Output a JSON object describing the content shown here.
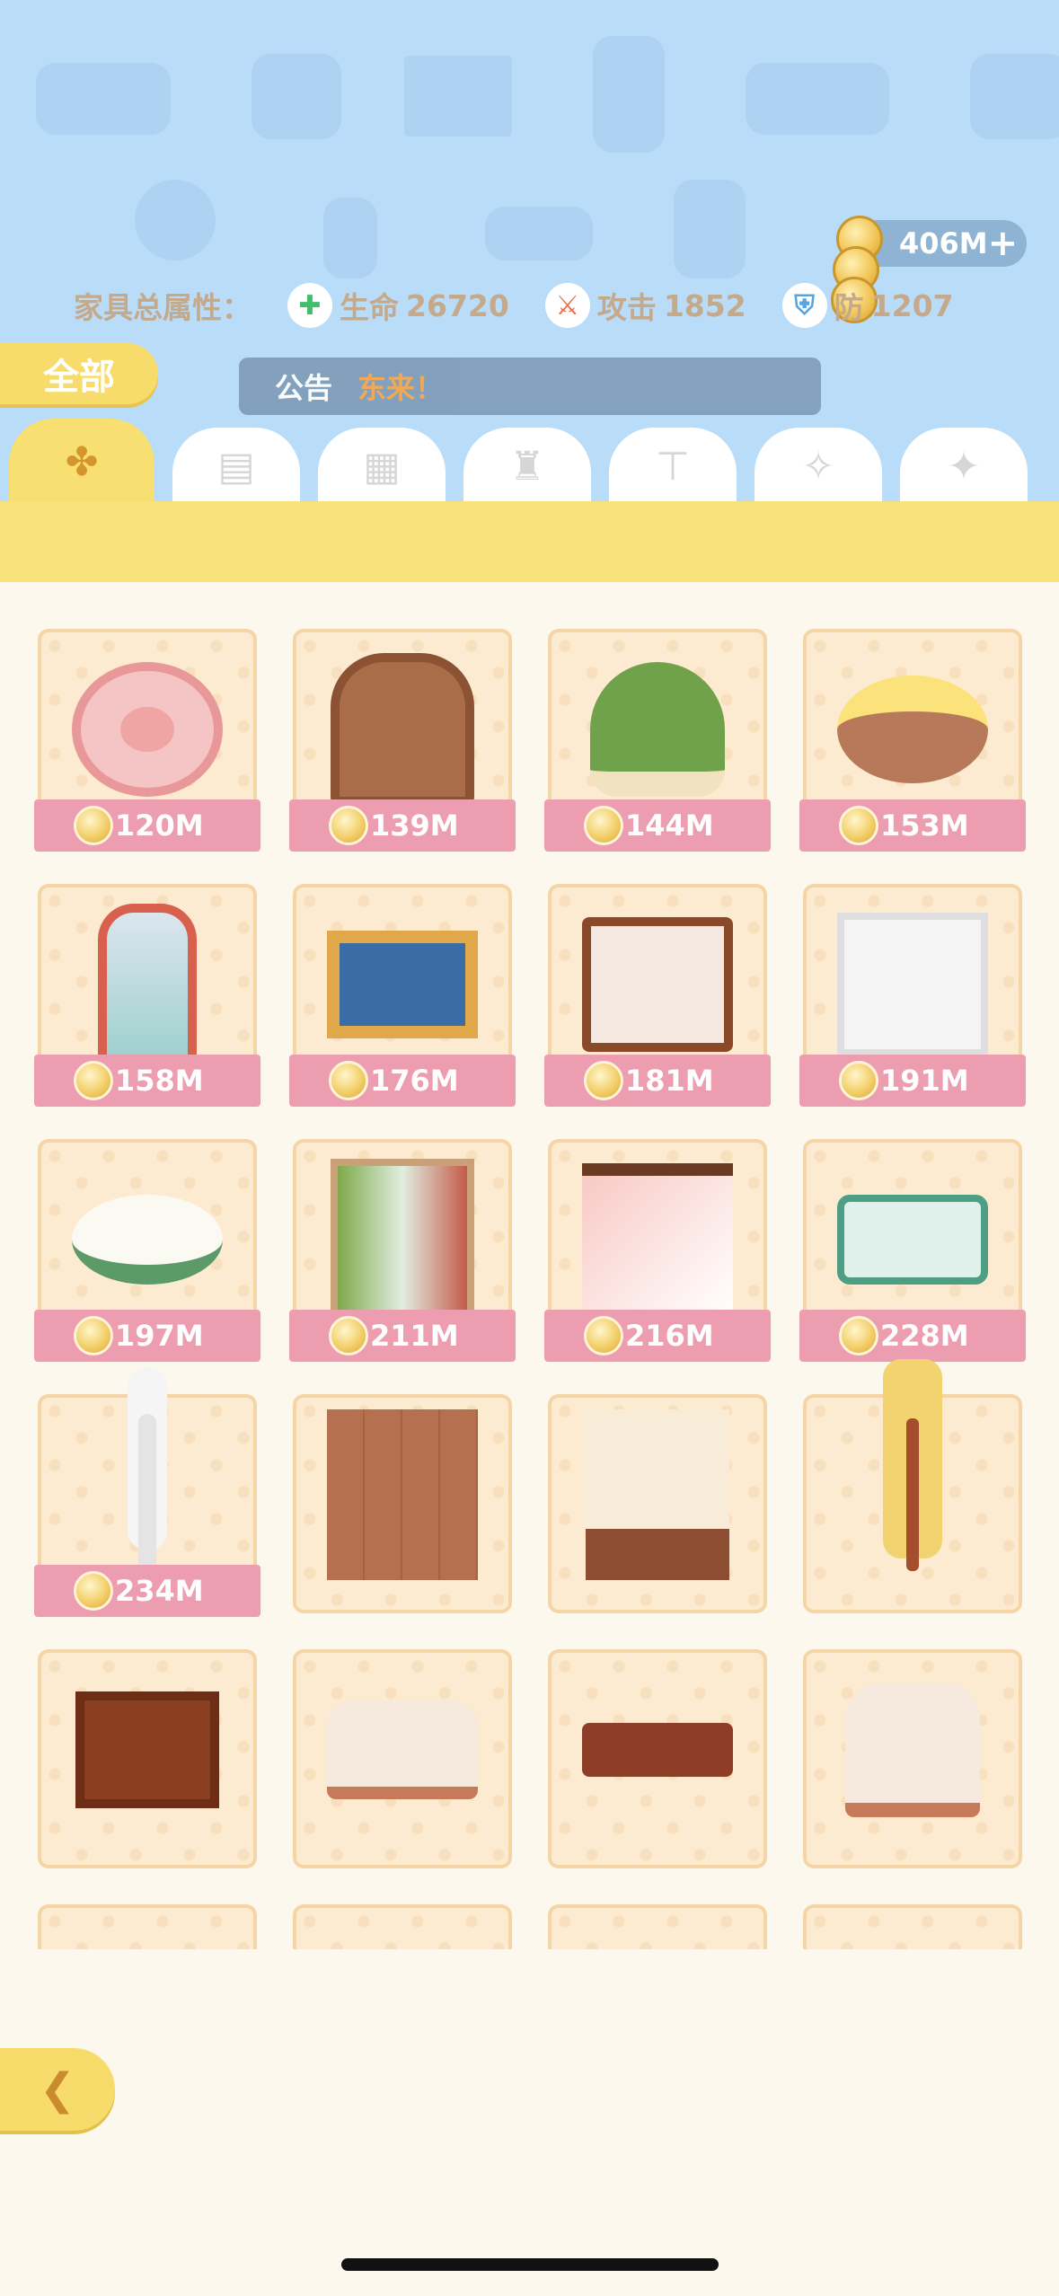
{
  "currency": {
    "amount": "406M",
    "add_symbol": "+"
  },
  "attributes": {
    "label": "家具总属性：",
    "items": [
      {
        "name": "生命",
        "value": "26720",
        "icon": "heart-plus-icon",
        "color": "#3fbf6b"
      },
      {
        "name": "攻击",
        "value": "1852",
        "icon": "sword-icon",
        "color": "#e2704c"
      },
      {
        "name": "防",
        "value": "1207",
        "icon": "shield-icon",
        "color": "#4fa6e8"
      }
    ]
  },
  "filter": {
    "all_label": "全部"
  },
  "notice": {
    "label": "公告",
    "message": "东来！"
  },
  "tabs": [
    {
      "icon": "clover-icon",
      "glyph": "✤",
      "active": true
    },
    {
      "icon": "wallpaper-icon",
      "glyph": "▤",
      "active": false
    },
    {
      "icon": "brick-floor-icon",
      "glyph": "▦",
      "active": false
    },
    {
      "icon": "lamp-icon",
      "glyph": "♜",
      "active": false
    },
    {
      "icon": "table-icon",
      "glyph": "⊤",
      "active": false
    },
    {
      "icon": "magic-wand-icon",
      "glyph": "✧",
      "active": false
    },
    {
      "icon": "sparkle-icon",
      "glyph": "✦",
      "active": false
    }
  ],
  "items": [
    {
      "art": "a-rug",
      "price": "120M"
    },
    {
      "art": "a-shelf",
      "price": "139M"
    },
    {
      "art": "a-plant",
      "price": "144M"
    },
    {
      "art": "a-bed-round",
      "price": "153M"
    },
    {
      "art": "a-mirror",
      "price": "158M"
    },
    {
      "art": "a-frame",
      "price": "176M"
    },
    {
      "art": "a-bed",
      "price": "181M"
    },
    {
      "art": "a-window",
      "price": "191M"
    },
    {
      "art": "a-cushion",
      "price": "197M"
    },
    {
      "art": "a-screen",
      "price": "211M"
    },
    {
      "art": "a-kimono",
      "price": "216M"
    },
    {
      "art": "a-mat",
      "price": "228M"
    },
    {
      "art": "a-lamp",
      "price": "234M"
    },
    {
      "art": "a-floor",
      "price": null
    },
    {
      "art": "a-wall",
      "price": null
    },
    {
      "art": "a-stand-lamp",
      "price": null
    },
    {
      "art": "a-fireplace",
      "price": null
    },
    {
      "art": "a-sofa",
      "price": null
    },
    {
      "art": "a-table",
      "price": null
    },
    {
      "art": "a-chair",
      "price": null
    },
    {
      "art": "a-strip1",
      "price": null
    },
    {
      "art": "a-strip2",
      "price": null
    },
    {
      "art": "a-strip3",
      "price": null
    },
    {
      "art": "a-strip4",
      "price": null
    }
  ],
  "back_button": {
    "icon": "back-arrow-icon",
    "glyph": "❮"
  }
}
